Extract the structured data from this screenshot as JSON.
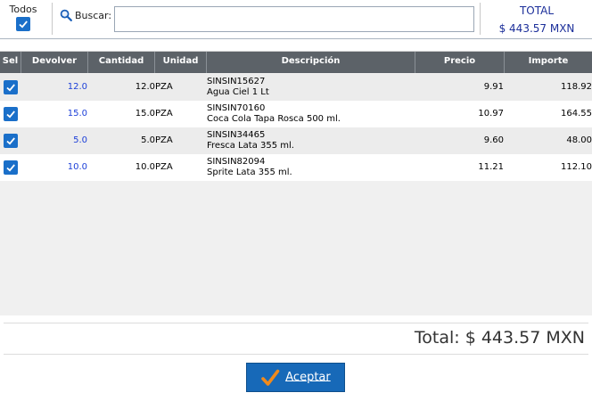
{
  "toolbar": {
    "todos_label": "Todos",
    "todos_checked": true,
    "search_label": "Buscar:",
    "search_value": "",
    "total_title": "TOTAL",
    "total_value": "$ 443.57 MXN"
  },
  "table": {
    "columns": [
      "Sel",
      "Devolver",
      "Cantidad",
      "Unidad",
      "Descripción",
      "Precio",
      "Importe"
    ],
    "rows": [
      {
        "selected": true,
        "devolver": "12.0",
        "cantidad": "12.0",
        "unidad": "PZA",
        "codigo": "SINSIN15627",
        "descripcion": "Agua Ciel 1 Lt",
        "precio": "9.91",
        "importe": "118.92"
      },
      {
        "selected": true,
        "devolver": "15.0",
        "cantidad": "15.0",
        "unidad": "PZA",
        "codigo": "SINSIN70160",
        "descripcion": "Coca Cola Tapa Rosca 500 ml.",
        "precio": "10.97",
        "importe": "164.55"
      },
      {
        "selected": true,
        "devolver": "5.0",
        "cantidad": "5.0",
        "unidad": "PZA",
        "codigo": "SINSIN34465",
        "descripcion": "Fresca Lata 355 ml.",
        "precio": "9.60",
        "importe": "48.00"
      },
      {
        "selected": true,
        "devolver": "10.0",
        "cantidad": "10.0",
        "unidad": "PZA",
        "codigo": "SINSIN82094",
        "descripcion": "Sprite Lata 355 ml.",
        "precio": "11.21",
        "importe": "112.10"
      }
    ]
  },
  "footer": {
    "total_text": "Total: $ 443.57 MXN",
    "accept_label": "Aceptar"
  },
  "icons": {
    "search": "search-icon",
    "checkmark": "checkmark-icon",
    "accept": "orange-checkmark-icon"
  },
  "colors": {
    "accent_blue": "#1a6fc9",
    "header_gray": "#5c6268",
    "total_text_blue": "#1c2f9a",
    "devolver_blue": "#1c3fd8",
    "accept_button": "#1769b8",
    "accept_check": "#f08a1c"
  }
}
